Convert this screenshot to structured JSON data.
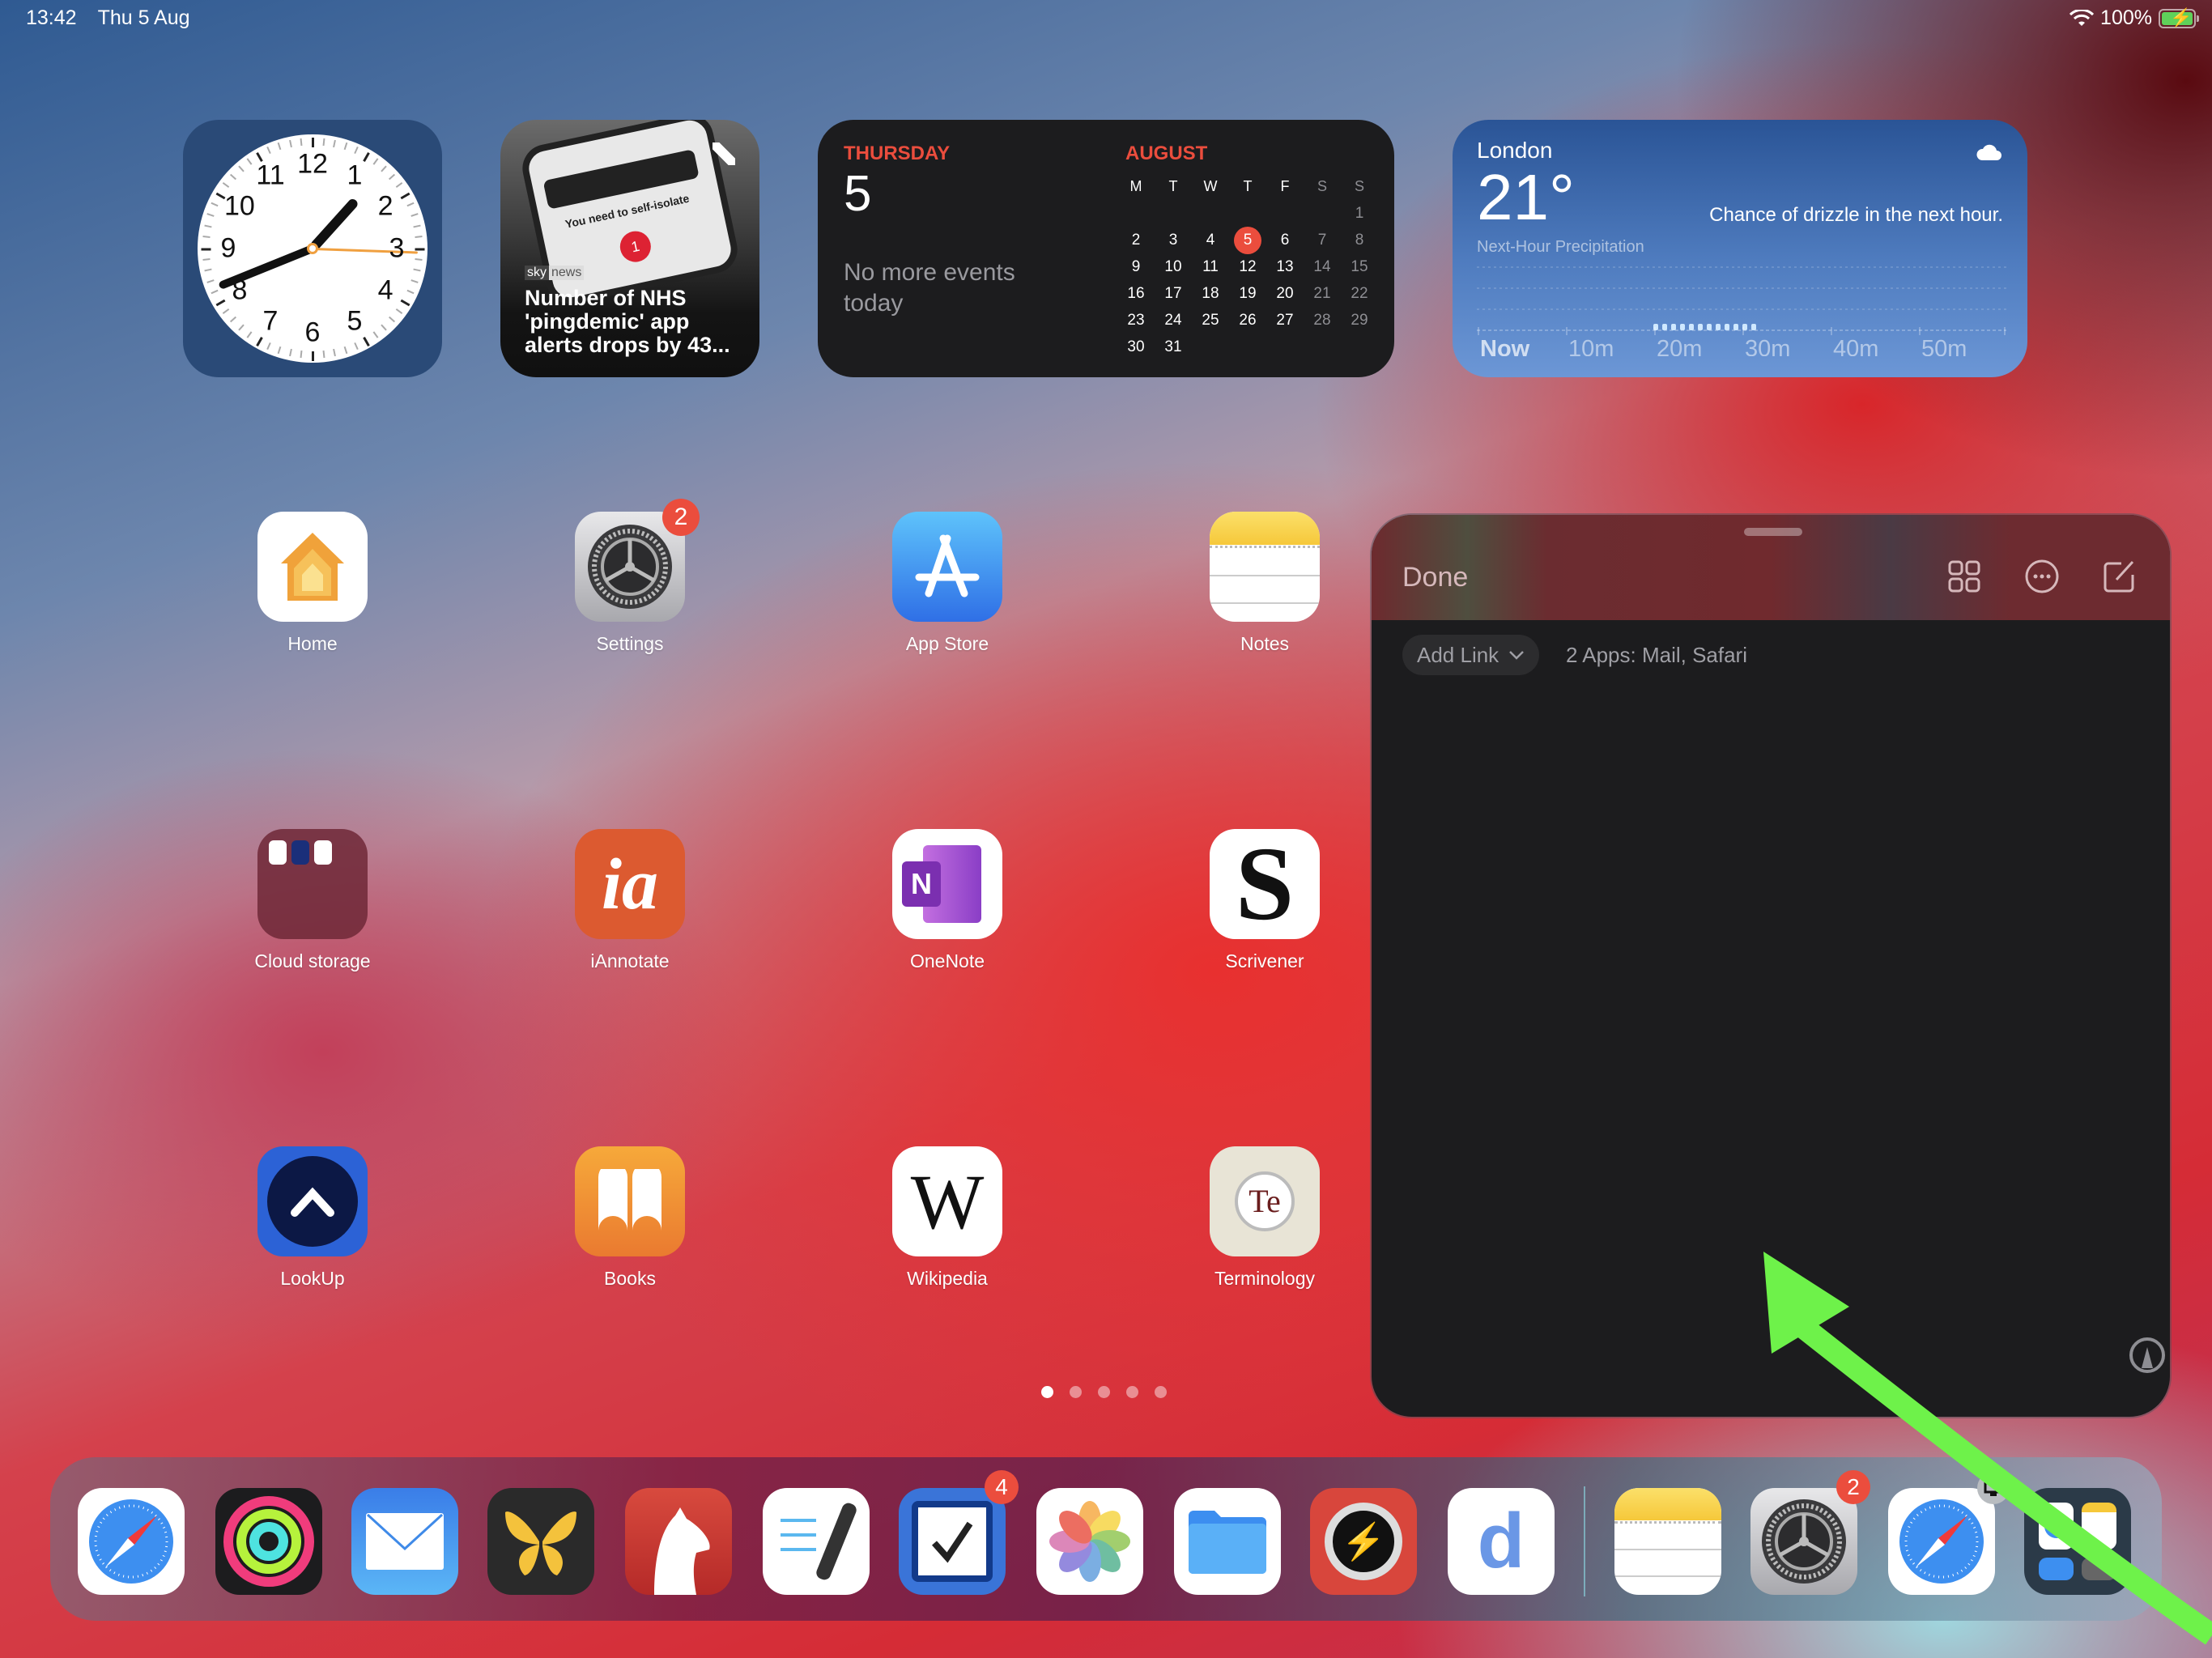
{
  "status_bar": {
    "time": "13:42",
    "date": "Thu 5 Aug",
    "battery": "100%",
    "wifi_icon": "wifi-icon",
    "battery_icon": "battery-charging-icon"
  },
  "widgets": {
    "clock": {
      "numbers": [
        "12",
        "1",
        "2",
        "3",
        "4",
        "5",
        "6",
        "7",
        "8",
        "9",
        "10",
        "11"
      ],
      "time_shown": "13:42"
    },
    "news": {
      "source_a": "sky",
      "source_b": "news",
      "headline": "Number of NHS 'pingdemic' app alerts drops by 43...",
      "image_text": "You need to self-isolate",
      "image_badge": "1"
    },
    "calendar": {
      "weekday": "THURSDAY",
      "day": "5",
      "events": "No more events today",
      "month": "AUGUST",
      "headers": [
        "M",
        "T",
        "W",
        "T",
        "F",
        "S",
        "S"
      ],
      "weeks": [
        [
          "",
          "",
          "",
          "",
          "",
          "",
          "1"
        ],
        [
          "2",
          "3",
          "4",
          "5",
          "6",
          "7",
          "8"
        ],
        [
          "9",
          "10",
          "11",
          "12",
          "13",
          "14",
          "15"
        ],
        [
          "16",
          "17",
          "18",
          "19",
          "20",
          "21",
          "22"
        ],
        [
          "23",
          "24",
          "25",
          "26",
          "27",
          "28",
          "29"
        ],
        [
          "30",
          "31",
          "",
          "",
          "",
          "",
          ""
        ]
      ],
      "today": "5"
    },
    "weather": {
      "city": "London",
      "temp": "21°",
      "condition": "Chance of drizzle in the next hour.",
      "subtitle": "Next-Hour Precipitation",
      "ticks": [
        "Now",
        "10m",
        "20m",
        "30m",
        "40m",
        "50m"
      ],
      "icon": "cloud-icon"
    }
  },
  "apps": [
    {
      "label": "Home",
      "icon": "home-icon"
    },
    {
      "label": "Settings",
      "icon": "gear-icon",
      "badge": "2"
    },
    {
      "label": "App Store",
      "icon": "app-store-icon"
    },
    {
      "label": "Notes",
      "icon": "notes-icon"
    },
    {
      "label": "Cloud storage",
      "icon": "folder-icon"
    },
    {
      "label": "iAnnotate",
      "icon": "iannotate-icon",
      "glyph": "ia"
    },
    {
      "label": "OneNote",
      "icon": "onenote-icon",
      "glyph": "N"
    },
    {
      "label": "Scrivener",
      "icon": "scrivener-icon",
      "glyph": "S"
    },
    {
      "label": "LookUp",
      "icon": "lookup-icon"
    },
    {
      "label": "Books",
      "icon": "books-icon"
    },
    {
      "label": "Wikipedia",
      "icon": "wikipedia-icon",
      "glyph": "W"
    },
    {
      "label": "Terminology",
      "icon": "terminology-icon",
      "glyph": "Te"
    }
  ],
  "page_indicator": {
    "pages": 5,
    "current": 1
  },
  "dock": {
    "items": [
      {
        "name": "Safari",
        "icon": "safari-icon"
      },
      {
        "name": "Fitness",
        "icon": "activity-rings-icon"
      },
      {
        "name": "Mail",
        "icon": "mail-icon"
      },
      {
        "name": "Ulysses",
        "icon": "butterfly-icon"
      },
      {
        "name": "Bear",
        "icon": "bear-icon"
      },
      {
        "name": "GoodNotes",
        "icon": "pen-notes-icon"
      },
      {
        "name": "Things",
        "icon": "checkbox-icon",
        "badge": "4"
      },
      {
        "name": "Photos",
        "icon": "photos-icon"
      },
      {
        "name": "Files",
        "icon": "files-folder-icon"
      },
      {
        "name": "Quick app",
        "icon": "lightning-q-icon"
      },
      {
        "name": "Dictionary",
        "icon": "d-letter-icon",
        "glyph": "d"
      }
    ],
    "recents": [
      {
        "name": "Notes",
        "icon": "notes-icon"
      },
      {
        "name": "Settings",
        "icon": "gear-icon",
        "badge": "2"
      },
      {
        "name": "Safari",
        "icon": "safari-icon",
        "sub_badge": "display-icon"
      },
      {
        "name": "App Library",
        "icon": "app-library-icon"
      }
    ]
  },
  "slide_over": {
    "done_label": "Done",
    "add_link_label": "Add Link",
    "linked_apps": "2 Apps: Mail, Safari",
    "toolbar_icons": [
      "grid-icon",
      "more-icon",
      "compose-icon"
    ],
    "markup_icon": "markup-pen-icon"
  },
  "annotation": {
    "color": "#6ef24a",
    "type": "arrow"
  },
  "colors": {
    "calendar_red": "#eb4d3d",
    "badge_red": "#eb4d3d",
    "slideover_bg": "#1c1c1e"
  }
}
